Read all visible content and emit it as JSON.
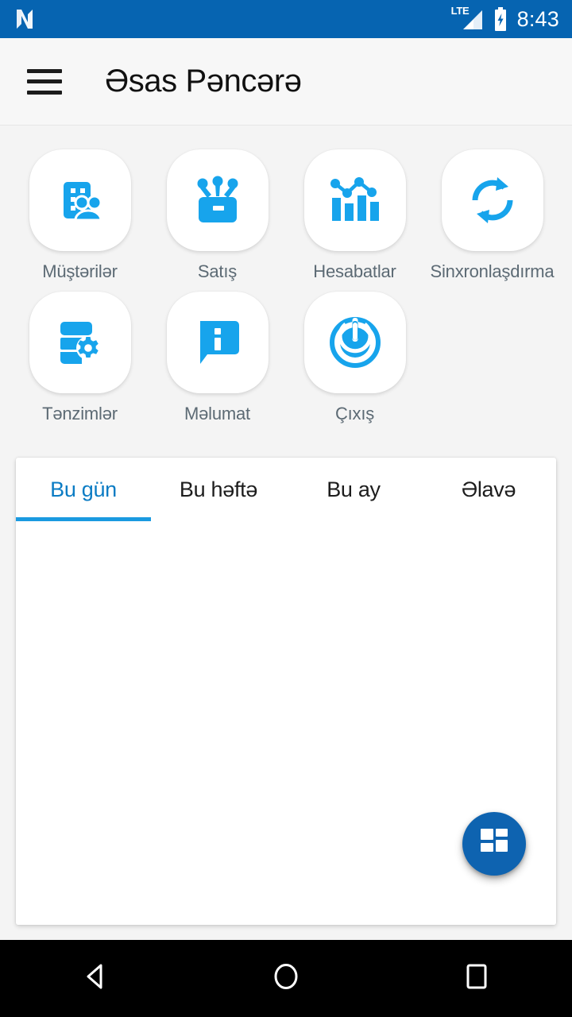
{
  "statusbar": {
    "logo_icon": "nougat-n-logo-icon",
    "network_label": "LTE",
    "signal_icon": "signal-bars-icon",
    "battery_icon": "battery-charging-icon",
    "time": "8:43",
    "bg_color": "#0664B1"
  },
  "appbar": {
    "menu_icon": "hamburger-menu-icon",
    "title": "Əsas Pəncərə",
    "bg_color": "#f7f7f7"
  },
  "shortcuts": {
    "accent_color": "#17A4EC",
    "rows": [
      [
        {
          "label": "Müştərilər",
          "icon": "customers-building-people-icon"
        },
        {
          "label": "Satış",
          "icon": "sales-cashbox-icon"
        },
        {
          "label": "Hesabatlar",
          "icon": "reports-bar-chart-icon"
        },
        {
          "label": "Sinxronlaşdırma",
          "icon": "sync-arrows-icon"
        }
      ],
      [
        {
          "label": "Tənzimlər",
          "icon": "settings-database-gear-icon"
        },
        {
          "label": "Məlumat",
          "icon": "info-speech-bubble-icon"
        },
        {
          "label": "Çıxış",
          "icon": "power-exit-icon"
        }
      ]
    ]
  },
  "content": {
    "tabs": [
      {
        "label": "Bu gün",
        "active": true
      },
      {
        "label": "Bu həftə",
        "active": false
      },
      {
        "label": "Bu ay",
        "active": false
      },
      {
        "label": "Əlavə",
        "active": false
      }
    ],
    "active_tab_color": "#0b7cc4",
    "panel_text": "",
    "fab": {
      "icon": "dashboard-grid-icon",
      "color": "#0E63B0"
    }
  },
  "navbar": {
    "back_icon": "back-triangle-icon",
    "home_icon": "home-circle-icon",
    "recents_icon": "recents-square-icon",
    "bg_color": "#000000"
  }
}
